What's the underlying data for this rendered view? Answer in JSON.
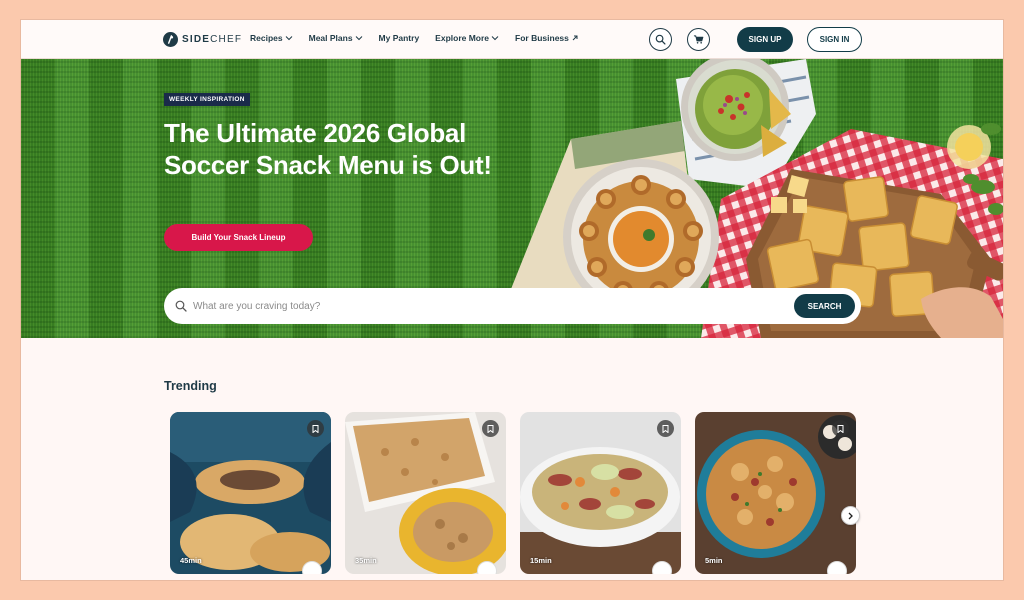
{
  "header": {
    "logo_bold": "SIDE",
    "logo_light": "CHEF",
    "nav": [
      {
        "label": "Recipes",
        "has_dropdown": true
      },
      {
        "label": "Meal Plans",
        "has_dropdown": true
      },
      {
        "label": "My Pantry",
        "has_dropdown": false
      },
      {
        "label": "Explore More",
        "has_dropdown": true
      },
      {
        "label": "For Business",
        "has_dropdown": false,
        "external": true
      }
    ],
    "sign_up": "SIGN UP",
    "sign_in": "SIGN IN"
  },
  "hero": {
    "badge": "WEEKLY INSPIRATION",
    "title": "The Ultimate 2026 Global Soccer Snack Menu is Out!",
    "cta": "Build Your Snack Lineup",
    "search_placeholder": "What are you craving today?",
    "search_button": "SEARCH"
  },
  "trending": {
    "title": "Trending",
    "cards": [
      {
        "time": "45min",
        "icon": "bookmark-icon"
      },
      {
        "time": "35min",
        "icon": "bookmark-icon"
      },
      {
        "time": "15min",
        "icon": "bookmark-icon"
      },
      {
        "time": "5min",
        "icon": "bookmark-icon"
      }
    ]
  },
  "colors": {
    "brand_dark": "#123c48",
    "cta_red": "#d8174a",
    "page_bg": "#fff7f5",
    "frame_bg": "#fbc9ad",
    "grass": "#3d8a26"
  }
}
